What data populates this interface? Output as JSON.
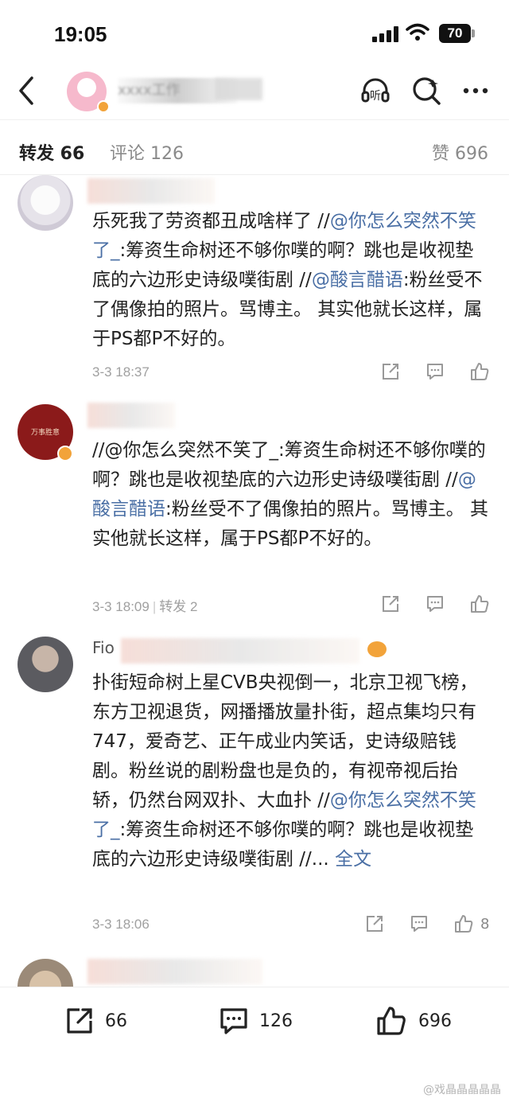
{
  "status": {
    "time": "19:05",
    "battery": "70"
  },
  "header": {
    "title": "xxxx工作"
  },
  "tabs": {
    "forward": "转发 66",
    "comment": "评论 126",
    "like": "赞 696"
  },
  "comments": [
    {
      "text_plain_1": "乐死我了劳资都丑成啥样了 //",
      "link_1": "@你怎么突然不笑了_",
      "text_plain_2": ":筹资生命树还不够你噗的啊？跳也是收视垫底的六边形史诗级噗街剧 //",
      "link_2": "@酸言醋语",
      "text_plain_3": ":粉丝受不了偶像拍的照片。骂博主。 其实他就长这样，属于PS都P不好的。",
      "date": "3-3 18:37"
    },
    {
      "text_plain_1": "//@你怎么突然不笑了_:筹资生命树还不够你噗的啊？跳也是收视垫底的六边形史诗级噗街剧 //",
      "link_1": "@酸言醋语",
      "text_plain_2": ":粉丝受不了偶像拍的照片。骂博主。 其实他就长这样，属于PS都P不好的。",
      "date": "3-3 18:09",
      "repost": "转发 2",
      "avatar_text": "万事胜意"
    },
    {
      "name_prefix": "Fio",
      "text_plain_1": "扑街短命树上星CVB央视倒一，北京卫视飞榜，东方卫视退货，网播播放量扑街，超点集均只有747，爱奇艺、正午成业内笑话，史诗级赔钱剧。粉丝说的剧粉盘也是负的，有视帝视后抬轿，仍然台网双扑、大血扑 //",
      "link_1": "@你怎么突然不笑了_",
      "text_plain_2": ":筹资生命树还不够你噗的啊？跳也是收视垫底的六边形史诗级噗街剧 //... ",
      "more": "全文",
      "date": "3-3 18:06",
      "likes": "8"
    }
  ],
  "footer": {
    "forward": "66",
    "comment": "126",
    "like": "696"
  },
  "watermark": "@戏晶晶晶晶晶",
  "colors": {
    "link": "#4a6fa5",
    "muted": "#a0a0a0"
  }
}
